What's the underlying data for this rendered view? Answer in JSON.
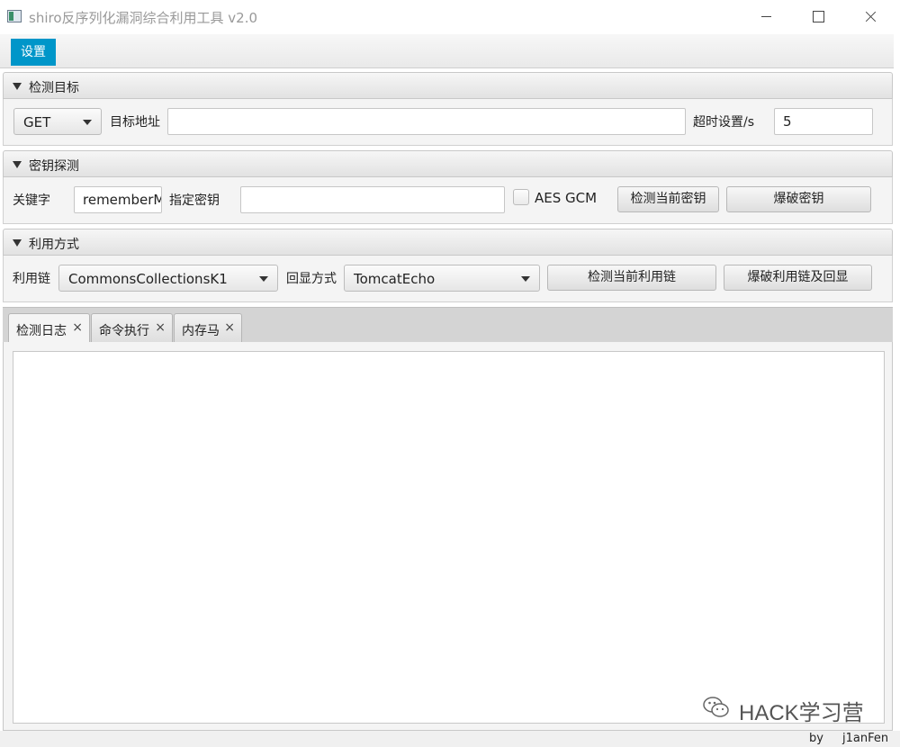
{
  "window": {
    "title": "shiro反序列化漏洞综合利用工具 v2.0"
  },
  "menu": {
    "settings_label": "设置"
  },
  "target_section": {
    "title": "检测目标",
    "method_value": "GET",
    "url_label": "目标地址",
    "url_value": "",
    "timeout_label": "超时设置/s",
    "timeout_value": "5"
  },
  "key_section": {
    "title": "密钥探测",
    "keyword_label": "关键字",
    "keyword_value": "rememberMe",
    "specified_key_label": "指定密钥",
    "specified_key_value": "",
    "aes_gcm_label": "AES GCM",
    "aes_gcm_checked": false,
    "detect_key_button": "检测当前密钥",
    "brute_key_button": "爆破密钥"
  },
  "exploit_section": {
    "title": "利用方式",
    "chain_label": "利用链",
    "chain_value": "CommonsCollectionsK1",
    "echo_label": "回显方式",
    "echo_value": "TomcatEcho",
    "detect_chain_button": "检测当前利用链",
    "brute_chain_button": "爆破利用链及回显"
  },
  "tabs": [
    {
      "label": "检测日志",
      "close": "×",
      "active": true
    },
    {
      "label": "命令执行",
      "close": "×",
      "active": false
    },
    {
      "label": "内存马",
      "close": "×",
      "active": false
    }
  ],
  "log": {
    "content": ""
  },
  "watermark": {
    "text": "HACK学习营"
  },
  "footer": {
    "by": "by",
    "author": "j1anFen"
  },
  "colors": {
    "accent": "#0096c9"
  }
}
